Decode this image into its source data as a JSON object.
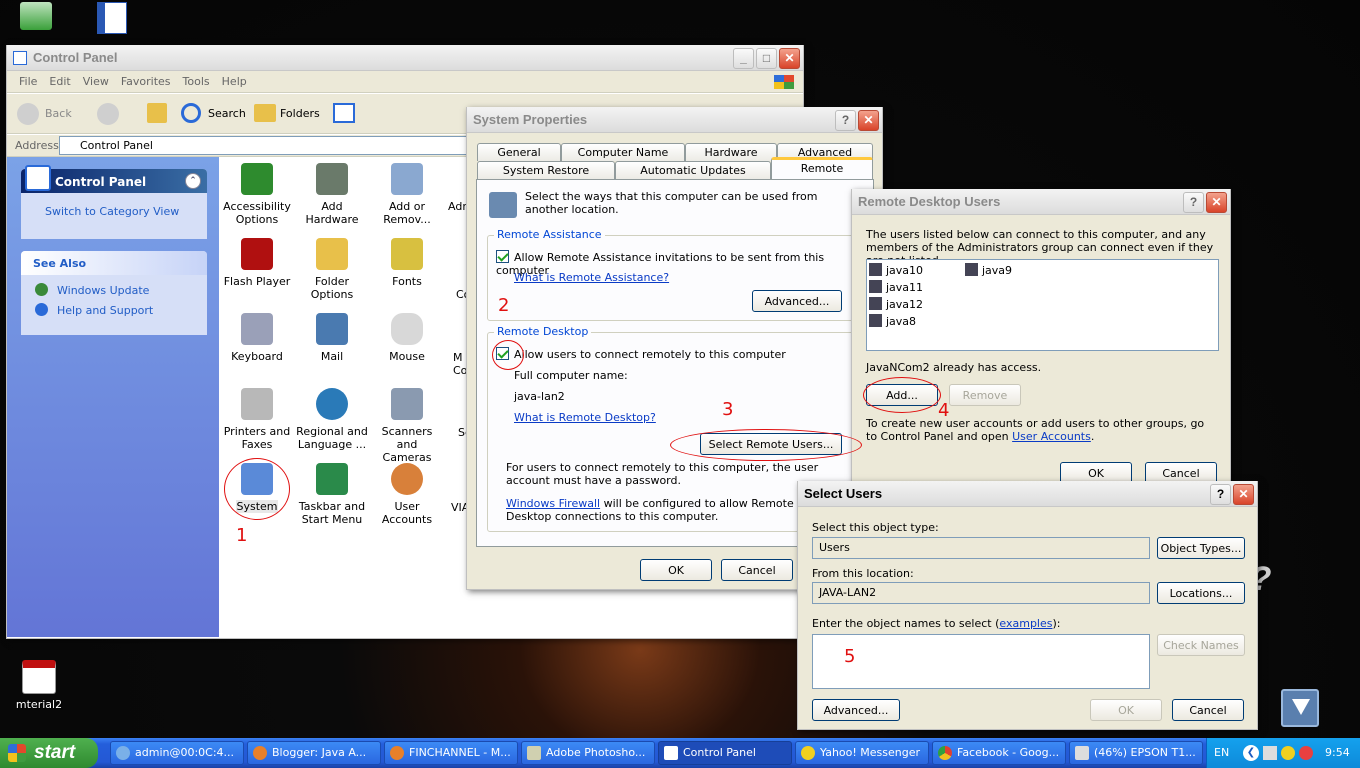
{
  "desktop": {
    "icons": [
      {
        "label": "mterial2"
      }
    ],
    "watermark": "E?"
  },
  "control_panel": {
    "title": "Control Panel",
    "menu": [
      "File",
      "Edit",
      "View",
      "Favorites",
      "Tools",
      "Help"
    ],
    "toolbar": {
      "back": "Back",
      "search": "Search",
      "folders": "Folders"
    },
    "address_label": "Address",
    "address_value": "Control Panel",
    "side": {
      "panel_title": "Control Panel",
      "switch": "Switch to Category View",
      "see_also": "See Also",
      "windows_update": "Windows Update",
      "help": "Help and Support"
    },
    "icons": [
      "Accessibility Options",
      "Add Hardware",
      "Add or Remov...",
      "Flash Player",
      "Folder Options",
      "Fonts",
      "Keyboard",
      "Mail",
      "Mouse",
      "Printers and Faxes",
      "Regional and Language ...",
      "Scanners and Cameras",
      "System",
      "Taskbar and Start Menu",
      "User Accounts"
    ],
    "partial": [
      "Adm",
      "Co",
      "M Co",
      "Se",
      "VIA"
    ]
  },
  "system_properties": {
    "title": "System Properties",
    "tabs_row1": [
      "General",
      "Computer Name",
      "Hardware",
      "Advanced"
    ],
    "tabs_row2": [
      "System Restore",
      "Automatic Updates",
      "Remote"
    ],
    "intro": "Select the ways that this computer can be used from another location.",
    "ra_group": "Remote Assistance",
    "ra_check": "Allow Remote Assistance invitations to be sent from this computer",
    "ra_link": "What is Remote Assistance?",
    "ra_adv": "Advanced...",
    "rd_group": "Remote Desktop",
    "rd_check": "Allow users to connect remotely to this computer",
    "fcn_label": "Full computer name:",
    "fcn_value": "java-lan2",
    "rd_link": "What is Remote Desktop?",
    "select_users": "Select Remote Users...",
    "note1": "For users to connect remotely to this computer, the user account must have a password.",
    "fw_link": "Windows Firewall",
    "note2": " will be configured to allow Remote Desktop connections to this computer.",
    "ok": "OK",
    "cancel": "Cancel"
  },
  "rdu": {
    "title": "Remote Desktop Users",
    "desc": "The users listed below can connect to this computer, and any members of the Administrators group can connect even if they are not listed.",
    "users": [
      "java10",
      "java11",
      "java12",
      "java8",
      "java9"
    ],
    "access": "JavaNCom2 already has access.",
    "add": "Add...",
    "remove": "Remove",
    "note": "To create new user accounts or add users to other groups, go to Control Panel and open ",
    "ua_link": "User Accounts",
    "note_end": ".",
    "ok": "OK",
    "cancel": "Cancel"
  },
  "select_users": {
    "title": "Select Users",
    "obj_type_label": "Select this object type:",
    "obj_type": "Users",
    "obj_types_btn": "Object Types...",
    "loc_label": "From this location:",
    "loc": "JAVA-LAN2",
    "loc_btn": "Locations...",
    "names_label_pre": "Enter the object names to select (",
    "names_link": "examples",
    "names_label_post": "):",
    "check": "Check Names",
    "advanced": "Advanced...",
    "ok": "OK",
    "cancel": "Cancel"
  },
  "annotations": [
    "1",
    "2",
    "3",
    "4",
    "5"
  ],
  "taskbar": {
    "start": "start",
    "tasks": [
      "admin@00:0C:4...",
      "Blogger: Java A...",
      "FINCHANNEL - M...",
      "Adobe Photosho...",
      "Control Panel",
      "Yahoo! Messenger",
      "Facebook - Goog...",
      "(46%) EPSON T1..."
    ],
    "lang": "EN",
    "clock": "9:54"
  },
  "colors": {
    "accent": "#0046d5",
    "annotation": "#e01010",
    "link": "#0a3bc6"
  }
}
